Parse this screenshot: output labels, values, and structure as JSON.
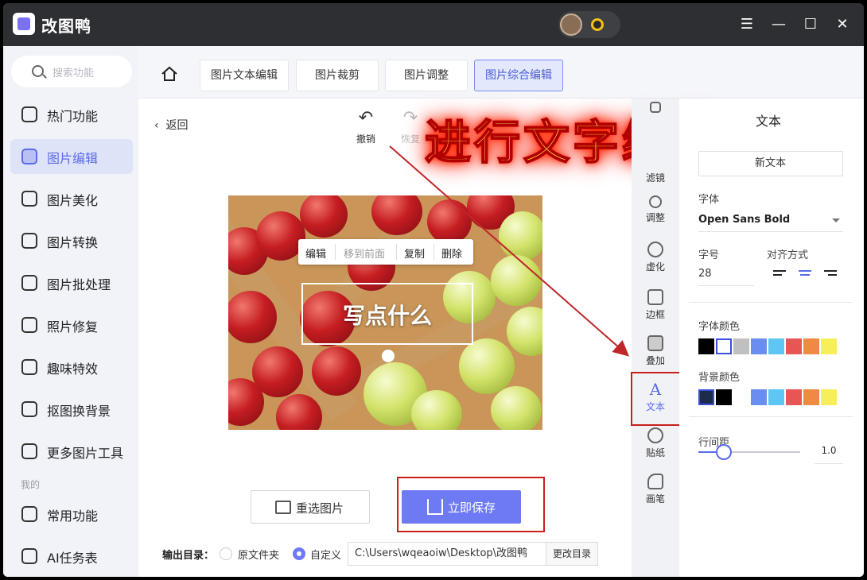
{
  "app": {
    "title": "改图鸭"
  },
  "sidebar": {
    "search_placeholder": "搜索功能",
    "items": [
      {
        "label": "热门功能"
      },
      {
        "label": "图片编辑"
      },
      {
        "label": "图片美化"
      },
      {
        "label": "图片转换"
      },
      {
        "label": "图片批处理"
      },
      {
        "label": "照片修复"
      },
      {
        "label": "趣味特效"
      },
      {
        "label": "抠图换背景"
      },
      {
        "label": "更多图片工具"
      }
    ],
    "section_my": "我的",
    "my_items": [
      {
        "label": "常用功能"
      },
      {
        "label": "AI任务表"
      }
    ]
  },
  "tabs": [
    {
      "label": "图片文本编辑"
    },
    {
      "label": "图片裁剪"
    },
    {
      "label": "图片调整"
    },
    {
      "label": "图片综合编辑"
    }
  ],
  "editor": {
    "back_label": "返回",
    "undo_label": "撤销",
    "redo_label": "恢复",
    "annotation": "进行文字编辑",
    "context_menu": [
      "编辑",
      "移到前面",
      "复制",
      "删除"
    ],
    "text_content": "写点什么",
    "reselect_label": "重选图片",
    "save_label": "立即保存",
    "output": {
      "label": "输出目录：",
      "option_original": "原文件夹",
      "option_custom": "自定义",
      "path": "C:\\Users\\wqeaoiw\\Desktop\\改图鸭",
      "change_label": "更改目录"
    }
  },
  "toolstrip": [
    {
      "label": "滤镜",
      "icon": "filter-icon"
    },
    {
      "label": "调整",
      "icon": "adjust-icon"
    },
    {
      "label": "虚化",
      "icon": "blur-icon"
    },
    {
      "label": "边框",
      "icon": "border-icon"
    },
    {
      "label": "叠加",
      "icon": "overlay-icon"
    },
    {
      "label": "文本",
      "icon": "text-icon"
    },
    {
      "label": "贴纸",
      "icon": "sticker-icon"
    },
    {
      "label": "画笔",
      "icon": "brush-icon"
    }
  ],
  "panel": {
    "title": "文本",
    "new_text_label": "新文本",
    "font_label": "字体",
    "font_value": "Open Sans Bold",
    "size_label": "字号",
    "size_value": "28",
    "align_label": "对齐方式",
    "font_color_label": "字体颜色",
    "bg_color_label": "背景颜色",
    "line_spacing_label": "行间距",
    "line_spacing_value": "1.0",
    "font_colors": [
      "#000000",
      "#ffffff",
      "#c0c0c0",
      "#6a8ef0",
      "#5ec6f2",
      "#e85555",
      "#ef8a45",
      "#f7ef5a"
    ],
    "bg_colors": [
      "#1e2b4a",
      "#000000",
      "#ffffff",
      "#6a8ef0",
      "#5ec6f2",
      "#e85555",
      "#ef8a45",
      "#f7ef5a"
    ]
  },
  "colors": {
    "accent": "#6d7af4",
    "highlight": "#c81e1e",
    "annotation_text": "#ffe24a"
  }
}
